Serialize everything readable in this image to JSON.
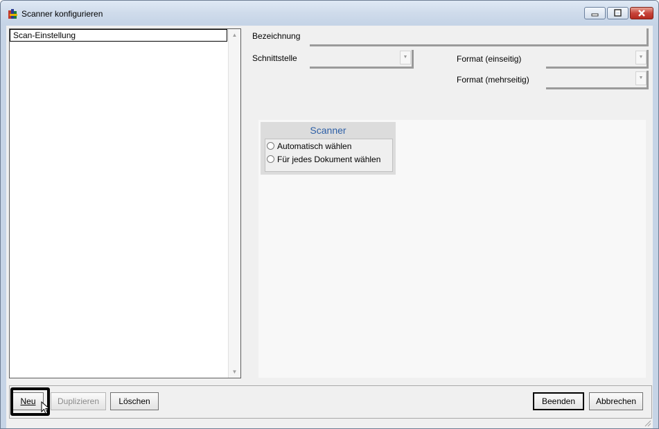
{
  "window": {
    "title": "Scanner konfigurieren",
    "controls": {
      "minimize": "minimize",
      "maximize": "maximize",
      "close": "close"
    }
  },
  "list": {
    "header": "Scan-Einstellung",
    "items": []
  },
  "form": {
    "bezeichnung_label": "Bezeichnung",
    "bezeichnung_value": "",
    "schnittstelle_label": "Schnittstelle",
    "schnittstelle_value": "",
    "format_einseitig_label": "Format (einseitig)",
    "format_einseitig_value": "",
    "format_mehrseitig_label": "Format (mehrseitig)",
    "format_mehrseitig_value": ""
  },
  "scanner": {
    "title": "Scanner",
    "options": [
      "Automatisch wählen",
      "Für jedes Dokument wählen"
    ],
    "selected": null
  },
  "buttons": {
    "neu": "Neu",
    "duplizieren": "Duplizieren",
    "loeschen": "Löschen",
    "beenden": "Beenden",
    "abbrechen": "Abbrechen"
  },
  "colors": {
    "title_bar": "#cfdbeb",
    "scanner_title": "#2d5fa6",
    "close_button": "#c7443a"
  }
}
